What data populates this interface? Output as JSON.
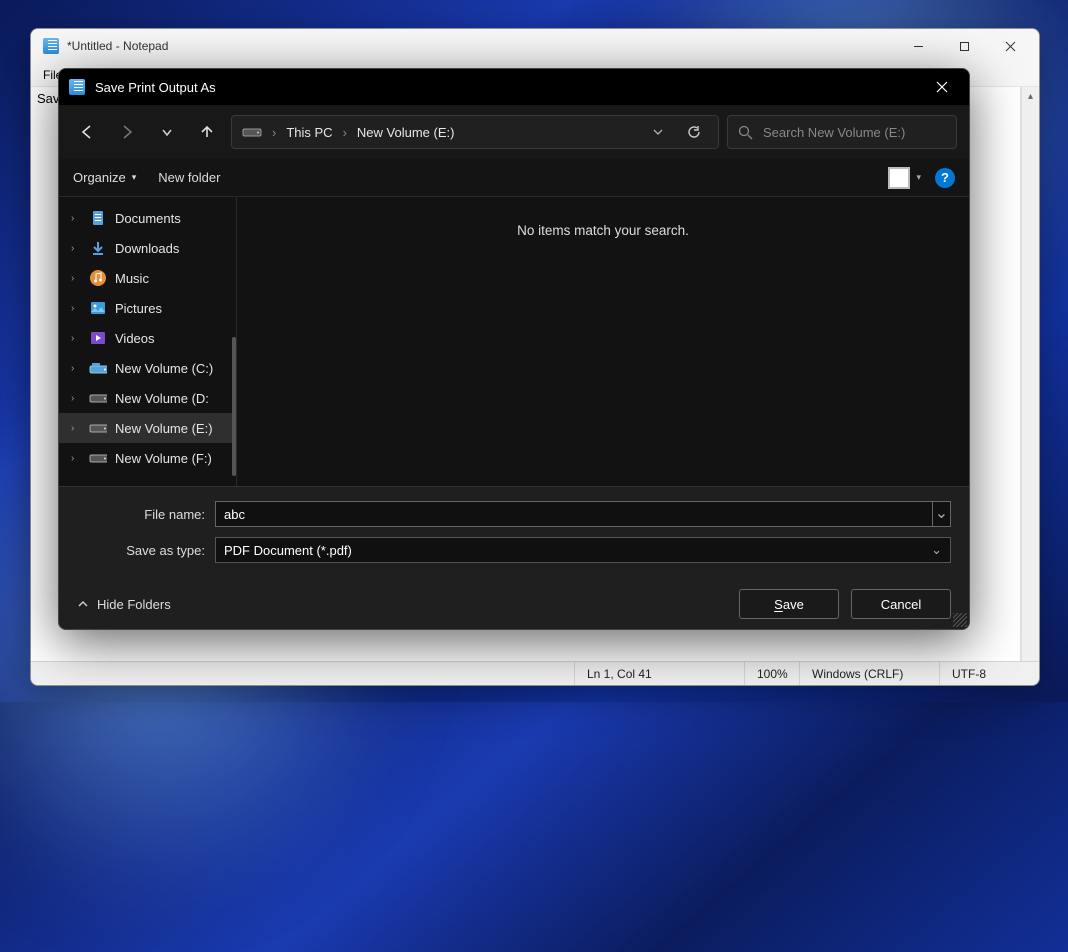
{
  "notepad": {
    "title": "*Untitled - Notepad",
    "menu_file": "File",
    "body_text": "Sav",
    "status": {
      "pos": "Ln 1, Col 41",
      "zoom": "100%",
      "eol": "Windows (CRLF)",
      "enc": "UTF-8"
    }
  },
  "dialog": {
    "title": "Save Print Output As",
    "breadcrumb": {
      "pc": "This PC",
      "vol": "New Volume (E:)"
    },
    "search_placeholder": "Search New Volume (E:)",
    "toolbar": {
      "organize": "Organize",
      "newfolder": "New folder"
    },
    "empty_msg": "No items match your search.",
    "tree": [
      {
        "label": "Documents",
        "icon": "doc"
      },
      {
        "label": "Downloads",
        "icon": "dl"
      },
      {
        "label": "Music",
        "icon": "music"
      },
      {
        "label": "Pictures",
        "icon": "pic"
      },
      {
        "label": "Videos",
        "icon": "vid"
      },
      {
        "label": "New Volume (C:)",
        "icon": "drive-c"
      },
      {
        "label": "New Volume (D:",
        "icon": "drive"
      },
      {
        "label": "New Volume (E:)",
        "icon": "drive",
        "sel": true
      },
      {
        "label": "New Volume (F:)",
        "icon": "drive"
      }
    ],
    "filename_label": "File name:",
    "filename_value": "abc",
    "type_label": "Save as type:",
    "type_value": "PDF Document (*.pdf)",
    "hide_folders": "Hide Folders",
    "save": "Save",
    "cancel": "Cancel"
  }
}
